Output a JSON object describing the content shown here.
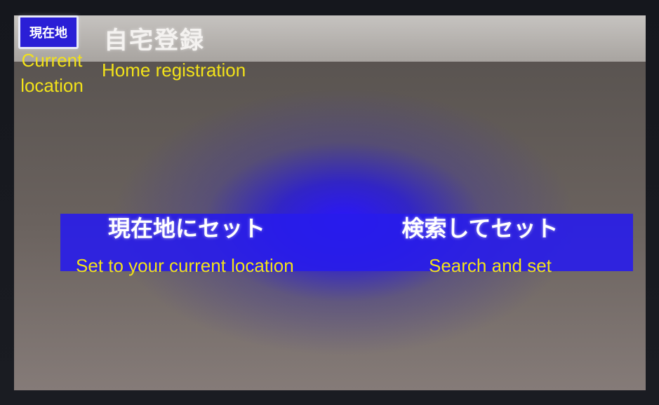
{
  "header": {
    "current_location_button_label": "現在地",
    "title": "自宅登録"
  },
  "actions": {
    "set_current_label": "現在地にセット",
    "search_set_label": "検索してセット"
  },
  "captions": {
    "current_location": "Current location",
    "home_registration": "Home registration",
    "set_current": "Set to your current location",
    "search_set": "Search and set"
  },
  "colors": {
    "accent_blue": "#2a1fd6",
    "caption_yellow": "#f2e21a",
    "title_bar": "#b8b4b0"
  }
}
